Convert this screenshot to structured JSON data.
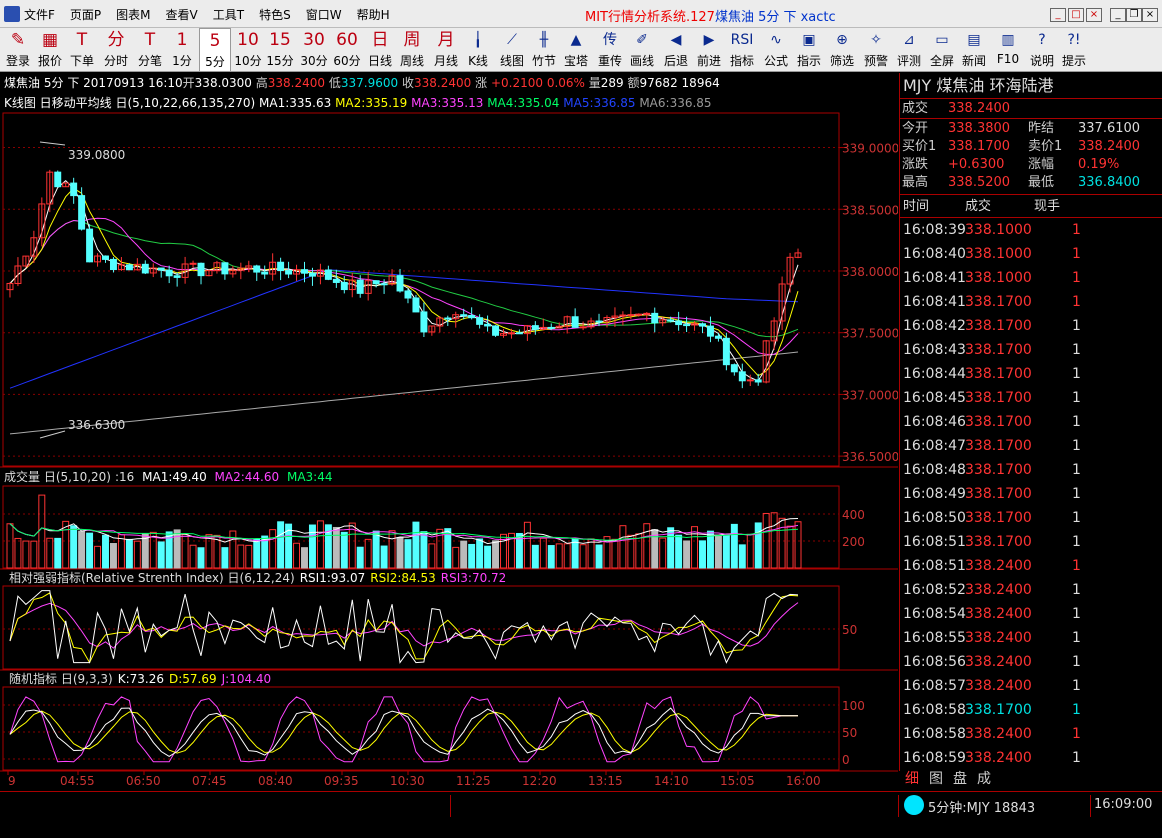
{
  "menu": [
    "文件F",
    "页面P",
    "图表M",
    "查看V",
    "工具T",
    "特色S",
    "窗口W",
    "帮助H"
  ],
  "window_title": {
    "prefix": "MIT行情分析系统.127",
    "suffix": "煤焦油 5分 下 xactc"
  },
  "toolbar": [
    {
      "label": "登录",
      "icon": "✎"
    },
    {
      "label": "报价",
      "icon": "▦"
    },
    {
      "label": "下单",
      "icon": "T"
    },
    {
      "label": "分时",
      "icon": "分"
    },
    {
      "label": "分笔",
      "icon": "T"
    },
    {
      "label": "1分",
      "icon": "1"
    },
    {
      "label": "5分",
      "icon": "5",
      "selected": true
    },
    {
      "label": "10分",
      "icon": "10"
    },
    {
      "label": "15分",
      "icon": "15"
    },
    {
      "label": "30分",
      "icon": "30"
    },
    {
      "label": "60分",
      "icon": "60"
    },
    {
      "label": "日线",
      "icon": "日"
    },
    {
      "label": "周线",
      "icon": "周"
    },
    {
      "label": "月线",
      "icon": "月"
    },
    {
      "label": "K线",
      "icon": "╽"
    },
    {
      "label": "线图",
      "icon": "⟋"
    },
    {
      "label": "竹节",
      "icon": "╫"
    },
    {
      "label": "宝塔",
      "icon": "▲"
    },
    {
      "label": "重传",
      "icon": "传"
    },
    {
      "label": "画线",
      "icon": "✐"
    },
    {
      "label": "后退",
      "icon": "◀"
    },
    {
      "label": "前进",
      "icon": "▶"
    },
    {
      "label": "指标",
      "icon": "RSI"
    },
    {
      "label": "公式",
      "icon": "∿"
    },
    {
      "label": "指示",
      "icon": "▣"
    },
    {
      "label": "筛选",
      "icon": "⊕"
    },
    {
      "label": "预警",
      "icon": "✧"
    },
    {
      "label": "评测",
      "icon": "⊿"
    },
    {
      "label": "全屏",
      "icon": "▭"
    },
    {
      "label": "新闻",
      "icon": "▤"
    },
    {
      "label": "F10",
      "icon": "▥"
    },
    {
      "label": "说明",
      "icon": "?"
    },
    {
      "label": "提示",
      "icon": "?!"
    }
  ],
  "info": {
    "name": "煤焦油",
    "period": "5分",
    "dir": "下",
    "date": "20170913",
    "time": "16:10",
    "open_lbl": "开",
    "open": "338.0300",
    "high_lbl": "高",
    "high": "338.2400",
    "low_lbl": "低",
    "low": "337.9600",
    "close_lbl": "收",
    "close": "338.2400",
    "chg_lbl": "涨",
    "chg": "+0.2100",
    "pct": "0.06%",
    "vol_lbl": "量",
    "vol": "289",
    "amt_lbl": "额",
    "amt": "97682",
    "extra": "18964"
  },
  "kchart": {
    "title": "K线图 日移动平均线 日(5,10,22,66,135,270)",
    "ma1": "MA1:335.63",
    "ma2": "MA2:335.19",
    "ma3": "MA3:335.13",
    "ma4": "MA4:335.04",
    "ma5": "MA5:336.85",
    "ma6": "MA6:336.85",
    "high_mark": "339.0800",
    "low_mark": "336.6300",
    "yticks": [
      "339.0000",
      "338.5000",
      "338.0000",
      "337.5000",
      "337.0000",
      "336.5000"
    ]
  },
  "volchart": {
    "title": "成交量 日(5,10,20)",
    "cur": ":16",
    "ma1": "MA1:49.40",
    "ma2": "MA2:44.60",
    "ma3": "MA3:44",
    "yticks": [
      "400",
      "200"
    ]
  },
  "rsichart": {
    "title": "相对强弱指标(Relative Strenth Index) 日(6,12,24)",
    "r1": "RSI1:93.07",
    "r2": "RSI2:84.53",
    "r3": "RSI3:70.72",
    "ytick": "50"
  },
  "kdjchart": {
    "title": "随机指标 日(9,3,3)",
    "k": "K:73.26",
    "d": "D:57.69",
    "j": "J:104.40",
    "yticks": [
      "100",
      "50",
      "0"
    ]
  },
  "xaxis": [
    "9",
    "04:55",
    "06:50",
    "07:45",
    "08:40",
    "09:35",
    "10:30",
    "11:25",
    "12:20",
    "13:15",
    "14:10",
    "15:05",
    "16:00"
  ],
  "panel": {
    "title": "MJY 煤焦油 环海陆港",
    "last_lbl": "成交",
    "last": "338.2400",
    "rows": [
      [
        "今开",
        "338.3800",
        "昨结",
        "337.6100"
      ],
      [
        "买价1",
        "338.1700",
        "卖价1",
        "338.2400"
      ],
      [
        "涨跌",
        "+0.6300",
        "涨幅",
        "0.19%"
      ],
      [
        "最高",
        "338.5200",
        "最低",
        "336.8400"
      ]
    ],
    "tick_headers": [
      "时间",
      "成交",
      "现手"
    ],
    "ticks": [
      [
        "16:08:39",
        "338.1000",
        "1",
        "r"
      ],
      [
        "16:08:40",
        "338.1000",
        "1",
        "r"
      ],
      [
        "16:08:41",
        "338.1000",
        "1",
        "r"
      ],
      [
        "16:08:41",
        "338.1700",
        "1",
        "r"
      ],
      [
        "16:08:42",
        "338.1700",
        "1",
        "w"
      ],
      [
        "16:08:43",
        "338.1700",
        "1",
        "w"
      ],
      [
        "16:08:44",
        "338.1700",
        "1",
        "w"
      ],
      [
        "16:08:45",
        "338.1700",
        "1",
        "w"
      ],
      [
        "16:08:46",
        "338.1700",
        "1",
        "w"
      ],
      [
        "16:08:47",
        "338.1700",
        "1",
        "w"
      ],
      [
        "16:08:48",
        "338.1700",
        "1",
        "w"
      ],
      [
        "16:08:49",
        "338.1700",
        "1",
        "w"
      ],
      [
        "16:08:50",
        "338.1700",
        "1",
        "w"
      ],
      [
        "16:08:51",
        "338.1700",
        "1",
        "w"
      ],
      [
        "16:08:51",
        "338.2400",
        "1",
        "r"
      ],
      [
        "16:08:52",
        "338.2400",
        "1",
        "w"
      ],
      [
        "16:08:54",
        "338.2400",
        "1",
        "w"
      ],
      [
        "16:08:55",
        "338.2400",
        "1",
        "w"
      ],
      [
        "16:08:56",
        "338.2400",
        "1",
        "w"
      ],
      [
        "16:08:57",
        "338.2400",
        "1",
        "w"
      ],
      [
        "16:08:58",
        "338.1700",
        "1",
        "c"
      ],
      [
        "16:08:58",
        "338.2400",
        "1",
        "r"
      ],
      [
        "16:08:59",
        "338.2400",
        "1",
        "w"
      ]
    ],
    "tabs": [
      "细",
      "图",
      "盘",
      "成"
    ]
  },
  "status": {
    "text": "5分钟:MJY 18843",
    "time": "16:09:00"
  }
}
